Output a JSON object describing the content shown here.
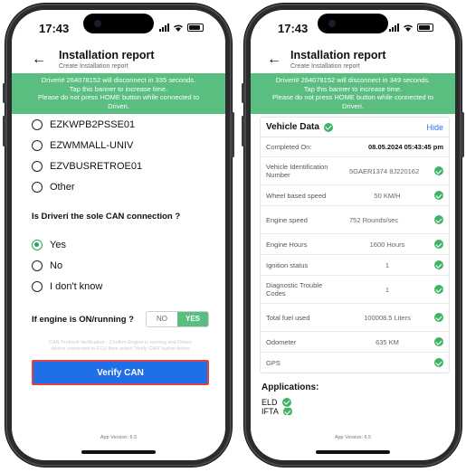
{
  "status": {
    "time": "17:43"
  },
  "left": {
    "header": {
      "back_icon": "arrow-left-icon",
      "title": "Installation report",
      "subtitle": "Create Installation report"
    },
    "banner": [
      "Driveri# 264078152 will disconnect in 335 seconds.",
      "Tap this banner to increase time.",
      "Please do not press HOME button while connected to",
      "Driveri."
    ],
    "options": [
      {
        "label": "EZKWPB2PSSE01",
        "selected": false
      },
      {
        "label": "EZWMMALL-UNIV",
        "selected": false
      },
      {
        "label": "EZVBUSRETROE01",
        "selected": false
      },
      {
        "label": "Other",
        "selected": false
      }
    ],
    "question": "Is Driveri the sole CAN connection ?",
    "answers": [
      {
        "label": "Yes",
        "selected": true
      },
      {
        "label": "No",
        "selected": false
      },
      {
        "label": "I don't know",
        "selected": false
      }
    ],
    "engine_question": "If engine is ON/running ?",
    "toggle": {
      "no": "NO",
      "yes": "YES",
      "selected": "YES"
    },
    "note": [
      "CAN Protocol Verification - Confirm Engine is running and Driveri",
      "device connected to ECU then select 'Verify CAN' button below"
    ],
    "verify_label": "Verify CAN",
    "version": "App Version: 6.5"
  },
  "right": {
    "header": {
      "back_icon": "arrow-left-icon",
      "title": "Installation report",
      "subtitle": "Create Installation report"
    },
    "banner": [
      "Driveri# 264078152 will disconnect in 349 seconds.",
      "Tap this banner to increase time.",
      "Please do not press HOME button while connected to",
      "Driveri."
    ],
    "card_title": "Vehicle Data",
    "hide_label": "Hide",
    "completed": {
      "label": "Completed On:",
      "value": "08.05.2024 05:43:45 pm"
    },
    "rows": [
      {
        "label": "Vehicle Identification Number",
        "value": "5GAER1374 8J220162"
      },
      {
        "label": "Wheel based speed",
        "value": "50 KM/H"
      },
      {
        "label": "Engine speed",
        "value": "752 Rounds/sec"
      },
      {
        "label": "Engine Hours",
        "value": "1600 Hours"
      },
      {
        "label": "Ignition status",
        "value": "1"
      },
      {
        "label": "Diagnostic Trouble Codes",
        "value": "1"
      },
      {
        "label": "Total fuel used",
        "value": "100008.5 Liters"
      },
      {
        "label": "Odometer",
        "value": "635 KM"
      },
      {
        "label": "GPS",
        "value": ""
      }
    ],
    "apps_title": "Applications:",
    "apps": [
      "ELD",
      "IFTA"
    ],
    "version": "App Version: 6.5"
  },
  "colors": {
    "banner": "#59be80",
    "verify": "#1f6fe8",
    "verify_border": "#e34141",
    "check": "#3fb465",
    "link": "#2e74f0"
  }
}
